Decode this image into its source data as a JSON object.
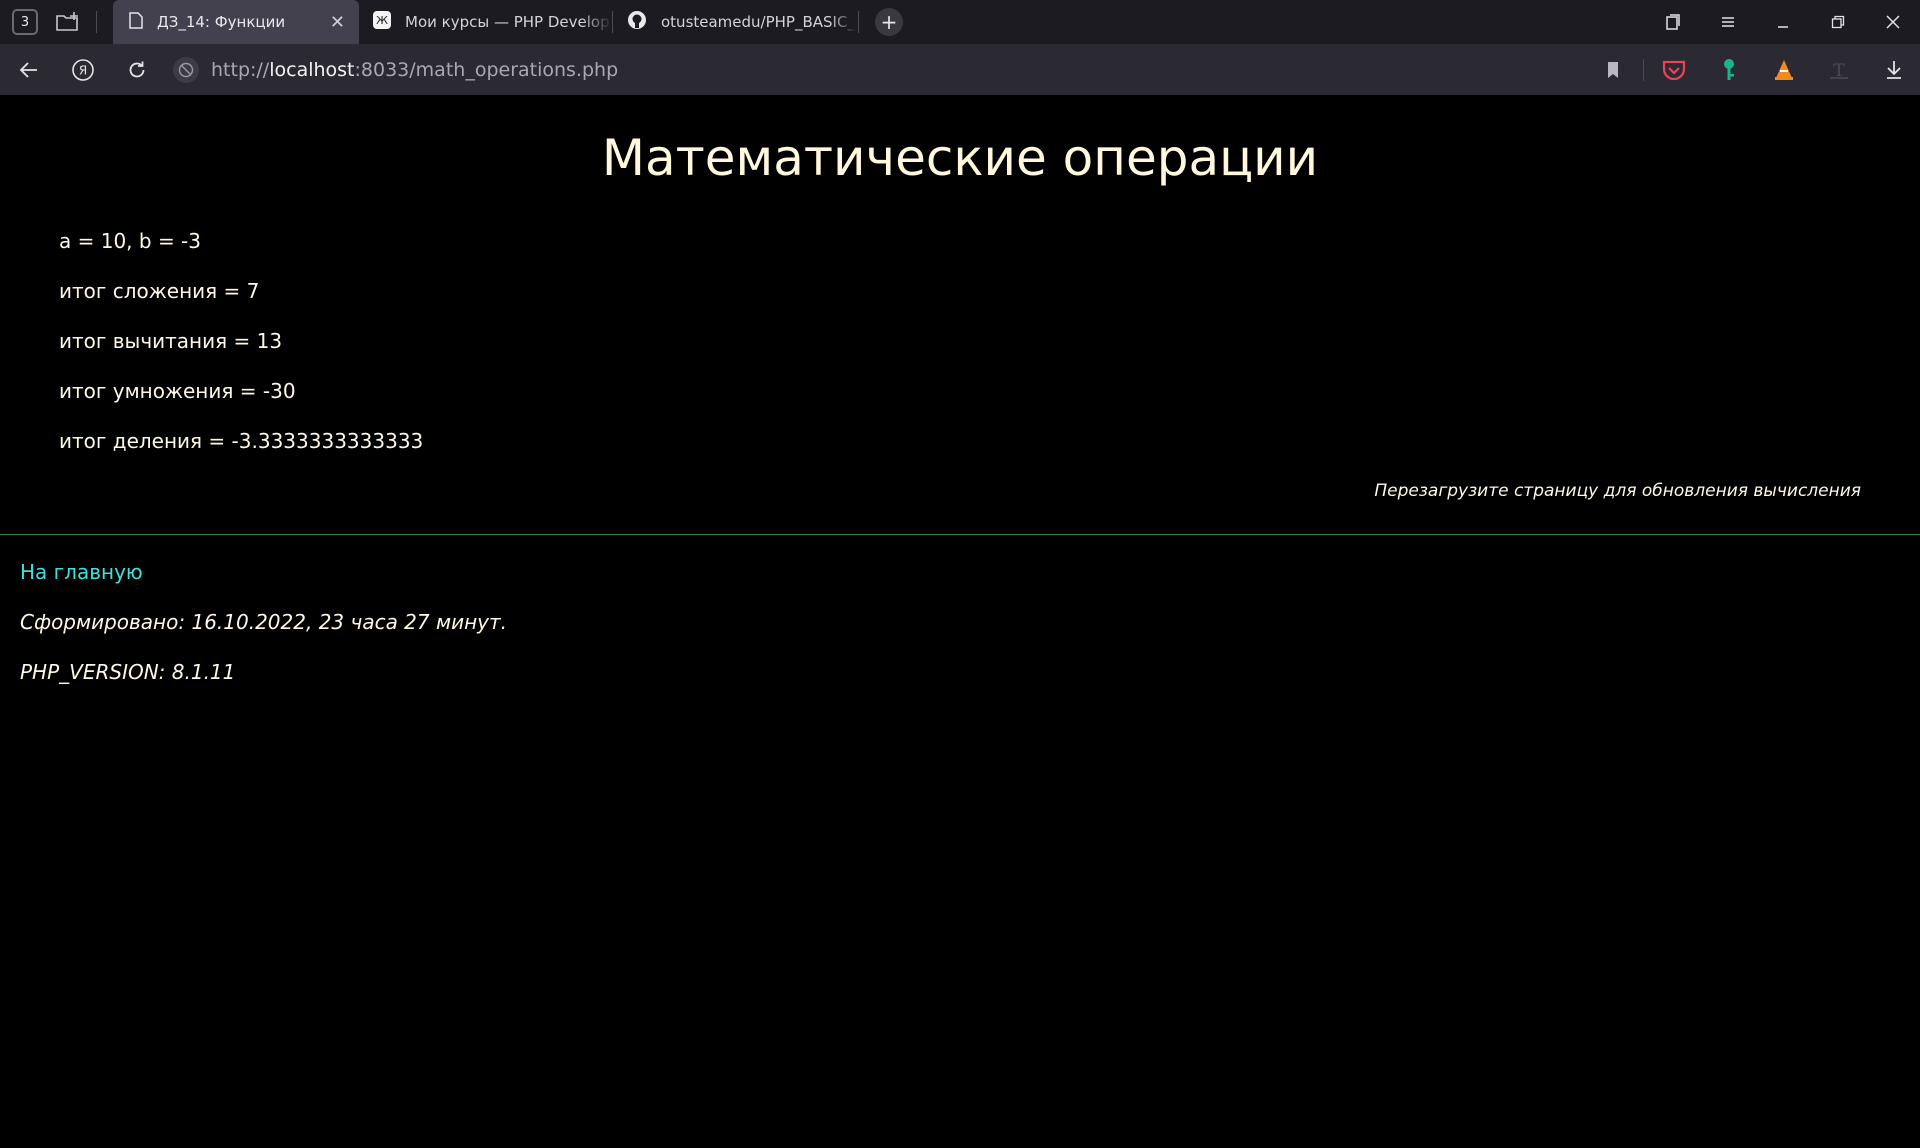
{
  "browser": {
    "tab_count": "3",
    "tabs": [
      {
        "title": "ДЗ_14: Функции",
        "active": true
      },
      {
        "title": "Мои курсы — PHP Develop",
        "active": false
      },
      {
        "title": "otusteamedu/PHP_BASIC_",
        "active": false
      }
    ],
    "url_prefix": "http://",
    "url_host": "localhost",
    "url_rest": ":8033/math_operations.php"
  },
  "page": {
    "title": "Математические операции",
    "values_line": "a = 10, b = -3",
    "results": [
      "итог сложения = 7",
      "итог вычитания = 13",
      "итог умножения = -30",
      "итог деления = -3.3333333333333"
    ],
    "reload_note": "Перезагрузите страницу для обновления вычисления",
    "home_link": "На главную",
    "generated": "Сформировано: 16.10.2022, 23 часа 27 минут.",
    "php_version": "PHP_VERSION: 8.1.11"
  },
  "colors": {
    "page_bg": "#000000",
    "text": "#fff8e6",
    "link": "#3fe0e0",
    "divider": "#3b7a3b"
  }
}
